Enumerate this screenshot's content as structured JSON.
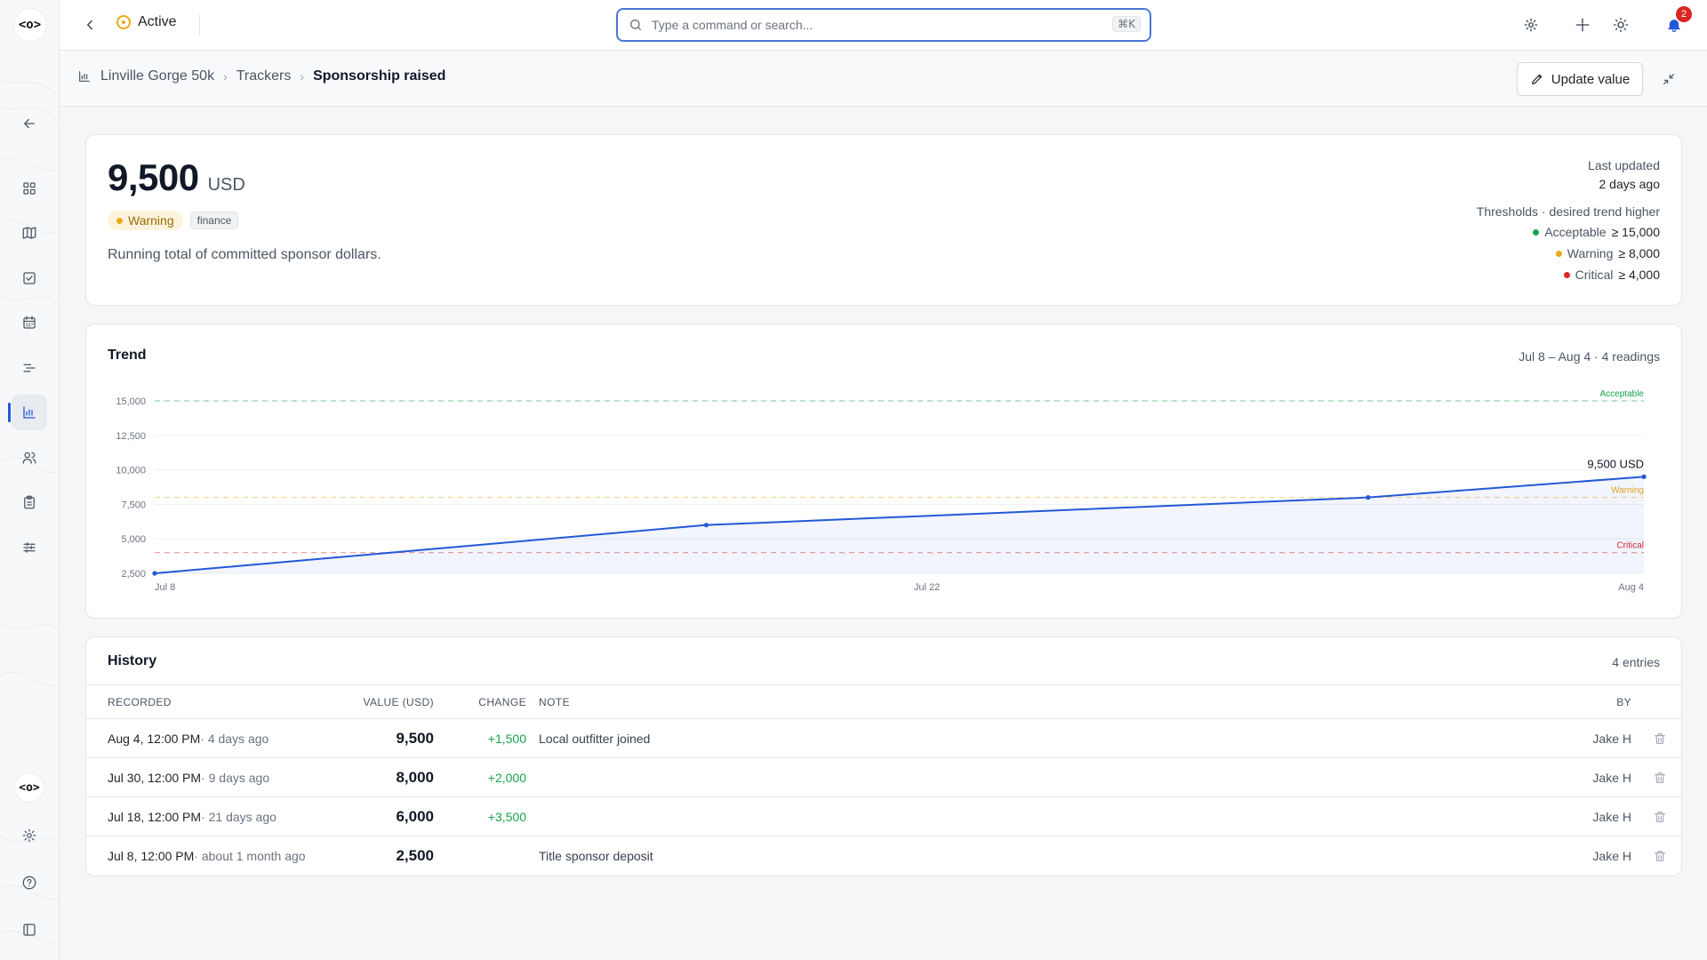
{
  "app": {
    "logo_text": "<o>"
  },
  "topbar": {
    "status_label": "Active",
    "search_placeholder": "Type a command or search...",
    "search_shortcut": "⌘K",
    "notification_count": "2"
  },
  "breadcrumb": {
    "items": [
      "Linville Gorge 50k",
      "Trackers",
      "Sponsorship raised"
    ]
  },
  "actions": {
    "update_label": "Update value"
  },
  "summary": {
    "value": "9,500",
    "unit": "USD",
    "status": "Warning",
    "tag": "finance",
    "description": "Running total of committed sponsor dollars.",
    "last_updated_label": "Last updated",
    "last_updated_value": "2 days ago",
    "thresholds_title": "Thresholds · desired trend higher",
    "thresholds": [
      {
        "label": "Acceptable",
        "value": "≥ 15,000",
        "color": "#16a34a"
      },
      {
        "label": "Warning",
        "value": "≥ 8,000",
        "color": "#e9a91a"
      },
      {
        "label": "Critical",
        "value": "≥ 4,000",
        "color": "#dc2626"
      }
    ]
  },
  "trend": {
    "title": "Trend",
    "meta": "Jul 8 – Aug 4 · 4 readings"
  },
  "chart_data": {
    "type": "line",
    "x": [
      "Jul 8",
      "Jul 18",
      "Jul 30",
      "Aug 4"
    ],
    "x_days": [
      0,
      10,
      22,
      27
    ],
    "values": [
      2500,
      6000,
      8000,
      9500
    ],
    "x_ticks": [
      "Jul 8",
      "Jul 22",
      "Aug 4"
    ],
    "x_tick_days": [
      0,
      14,
      27
    ],
    "y_ticks": [
      "2,500",
      "5,000",
      "7,500",
      "10,000",
      "12,500",
      "15,000"
    ],
    "y_tick_values": [
      2500,
      5000,
      7500,
      10000,
      12500,
      15000
    ],
    "ylim": [
      2500,
      15000
    ],
    "last_label": "9,500 USD",
    "threshold_lines": [
      {
        "label": "Acceptable",
        "value": 15000,
        "color": "#16a34a"
      },
      {
        "label": "Warning",
        "value": 8000,
        "color": "#e9a91a"
      },
      {
        "label": "Critical",
        "value": 4000,
        "color": "#dc2626"
      }
    ],
    "line_color": "#2458d6",
    "grid": true
  },
  "history": {
    "title": "History",
    "count": "4 entries",
    "columns": [
      "RECORDED",
      "VALUE (USD)",
      "CHANGE",
      "NOTE",
      "BY"
    ],
    "rows": [
      {
        "recorded": "Aug 4, 12:00 PM",
        "ago": " · 4 days ago",
        "value": "9,500",
        "change": "+1,500",
        "note": "Local outfitter joined",
        "by": "Jake H"
      },
      {
        "recorded": "Jul 30, 12:00 PM",
        "ago": " · 9 days ago",
        "value": "8,000",
        "change": "+2,000",
        "note": "",
        "by": "Jake H"
      },
      {
        "recorded": "Jul 18, 12:00 PM",
        "ago": " · 21 days ago",
        "value": "6,000",
        "change": "+3,500",
        "note": "",
        "by": "Jake H"
      },
      {
        "recorded": "Jul 8, 12:00 PM",
        "ago": " · about 1 month ago",
        "value": "2,500",
        "change": "",
        "note": "Title sponsor deposit",
        "by": "Jake H"
      }
    ]
  }
}
